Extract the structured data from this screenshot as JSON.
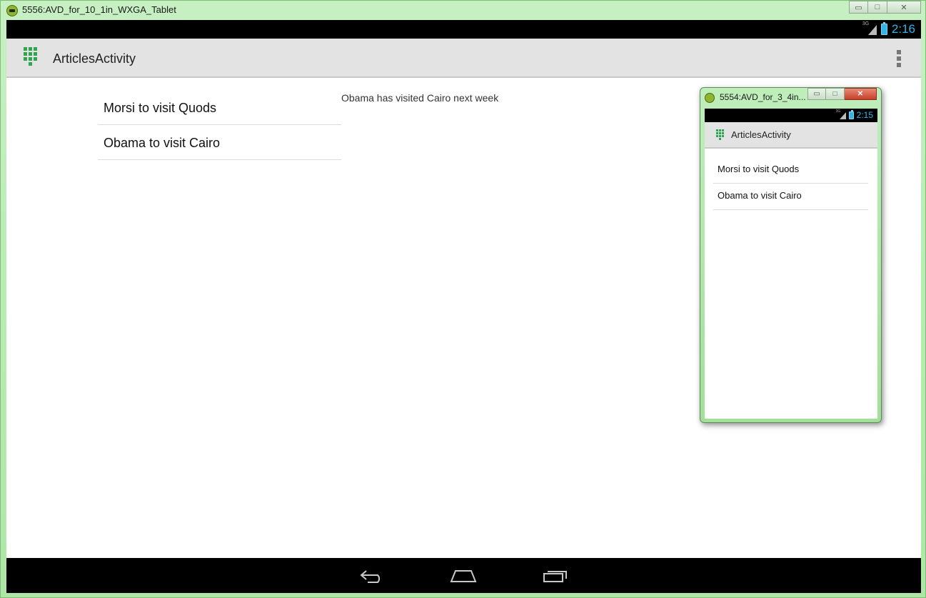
{
  "main_window": {
    "title": "5556:AVD_for_10_1in_WXGA_Tablet",
    "controls": {
      "minimize": "▭",
      "maximize": "□",
      "close": "✕"
    },
    "status_bar": {
      "network": "3G",
      "time": "2:16"
    },
    "action_bar": {
      "title": "ArticlesActivity",
      "app_icon": "app-grid-icon",
      "overflow_icon": "overflow-menu-icon"
    },
    "list": [
      {
        "label": "Morsi to visit Quods"
      },
      {
        "label": "Obama to visit Cairo"
      }
    ],
    "detail_text": "Obama has visited Cairo next week",
    "nav_bar": {
      "back_icon": "back-icon",
      "home_icon": "home-icon",
      "recents_icon": "recents-icon"
    }
  },
  "phone_window": {
    "title": "5554:AVD_for_3_4in...",
    "controls": {
      "minimize": "▭",
      "maximize": "□",
      "close": "✕"
    },
    "status_bar": {
      "network": "3G",
      "time": "2:15"
    },
    "action_bar": {
      "title": "ArticlesActivity"
    },
    "list": [
      {
        "label": "Morsi to visit Quods"
      },
      {
        "label": "Obama to visit Cairo"
      }
    ]
  },
  "colors": {
    "window_frame": "#b6e8b0",
    "accent": "#33b5e5",
    "app_icon": "#2ea550",
    "close_button": "#c8412a"
  }
}
